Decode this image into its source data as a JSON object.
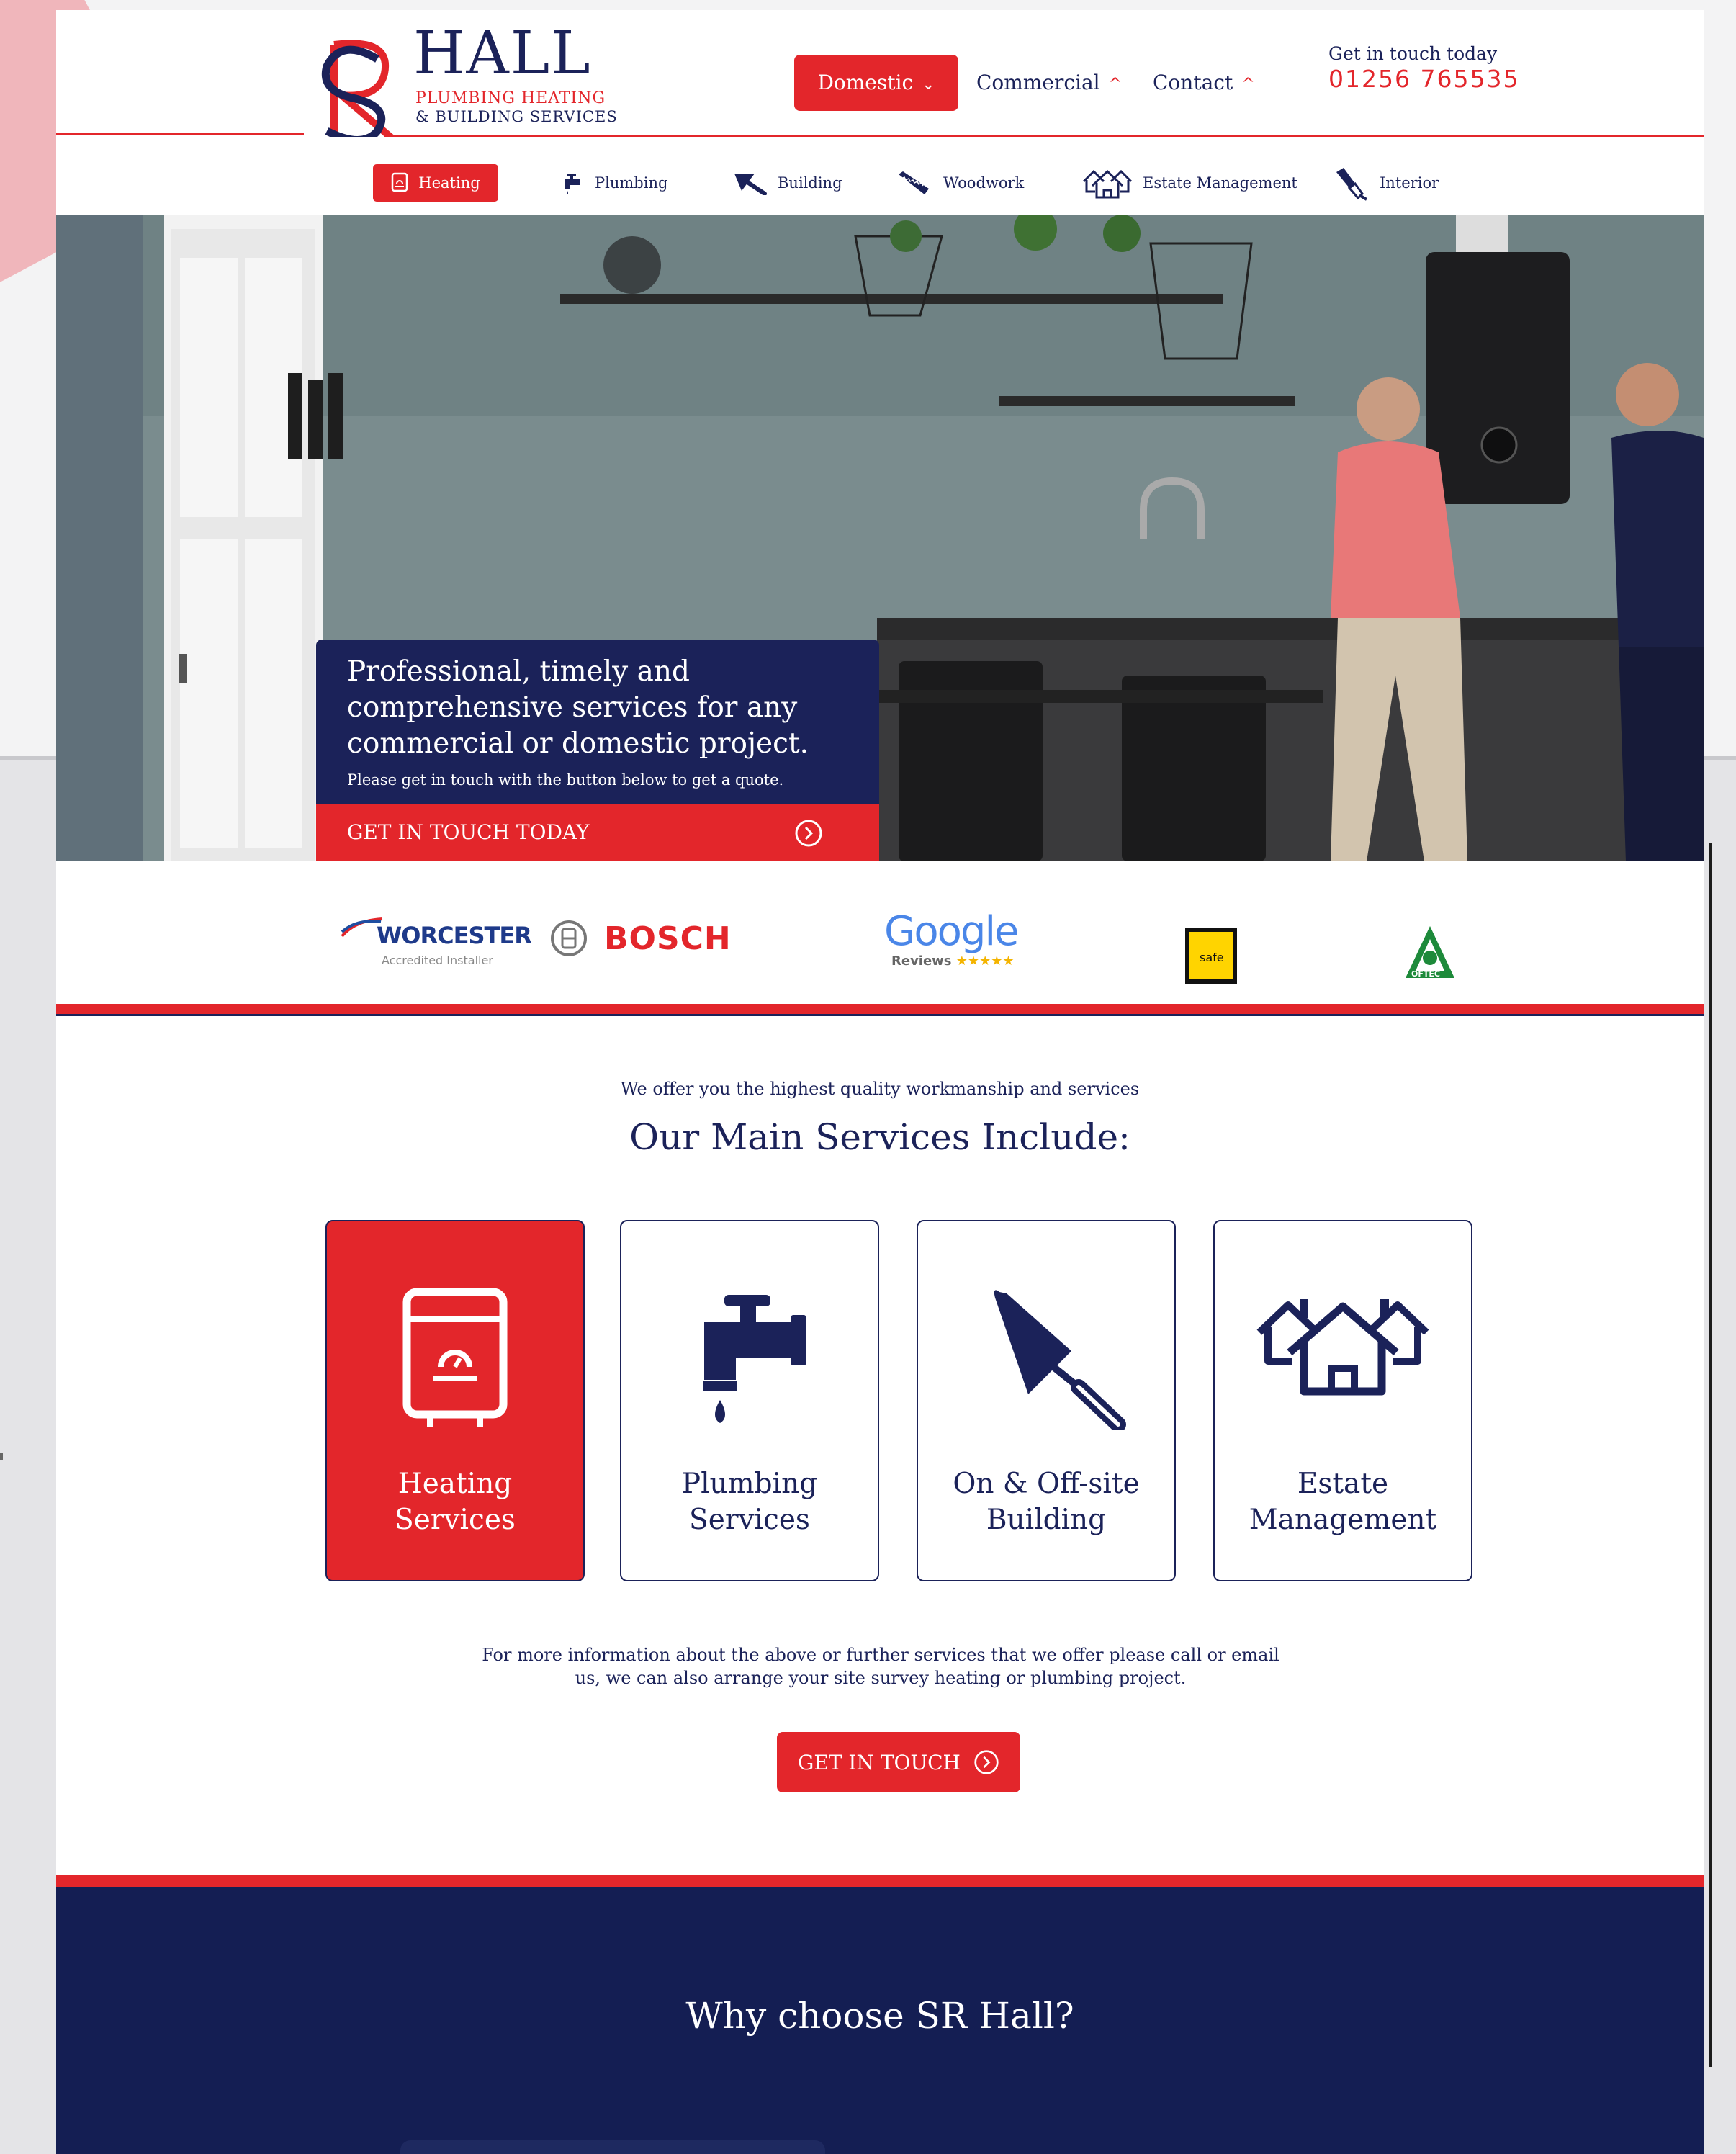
{
  "brand": {
    "monogram": "SR",
    "name": "HALL",
    "line1": "PLUMBING HEATING",
    "line2": "& BUILDING SERVICES"
  },
  "nav": {
    "domestic": "Domestic",
    "commercial": "Commercial",
    "contact": "Contact"
  },
  "contact": {
    "label": "Get in touch today",
    "phone": "01256 765535"
  },
  "subnav": [
    {
      "label": "Heating",
      "icon": "boiler-icon"
    },
    {
      "label": "Plumbing",
      "icon": "tap-icon"
    },
    {
      "label": "Building",
      "icon": "trowel-icon"
    },
    {
      "label": "Woodwork",
      "icon": "saw-icon"
    },
    {
      "label": "Estate Management",
      "icon": "houses-icon"
    },
    {
      "label": "Interior",
      "icon": "paintbrush-icon"
    }
  ],
  "hero": {
    "headline": "Professional, timely and comprehensive services for any commercial or domestic project.",
    "subtext": "Please get in touch with the button below to get a quote.",
    "cta": "GET IN TOUCH TODAY"
  },
  "partners": {
    "worcester": "WORCESTER",
    "worcester_sub": "Accredited Installer",
    "bosch": "BOSCH",
    "google": "Google",
    "google_sub": "Reviews",
    "gassafe": "safe",
    "oftec": "OFTEC"
  },
  "services": {
    "tagline": "We offer you the highest quality workmanship and services",
    "title": "Our Main Services Include:",
    "cards": [
      {
        "label": "Heating\nServices",
        "icon": "boiler-icon"
      },
      {
        "label": "Plumbing\nServices",
        "icon": "tap-icon"
      },
      {
        "label": "On & Off-site\nBuilding",
        "icon": "trowel-icon"
      },
      {
        "label": "Estate\nManagement",
        "icon": "houses-icon"
      }
    ],
    "info": "For more information about the above or further services that we offer please call or email us, we can also arrange your site survey heating or plumbing project.",
    "cta": "GET IN TOUCH"
  },
  "why": {
    "title": "Why choose SR Hall?"
  },
  "colors": {
    "brand_red": "#e3262b",
    "brand_navy": "#1b2259",
    "dark_navy": "#141e53"
  }
}
